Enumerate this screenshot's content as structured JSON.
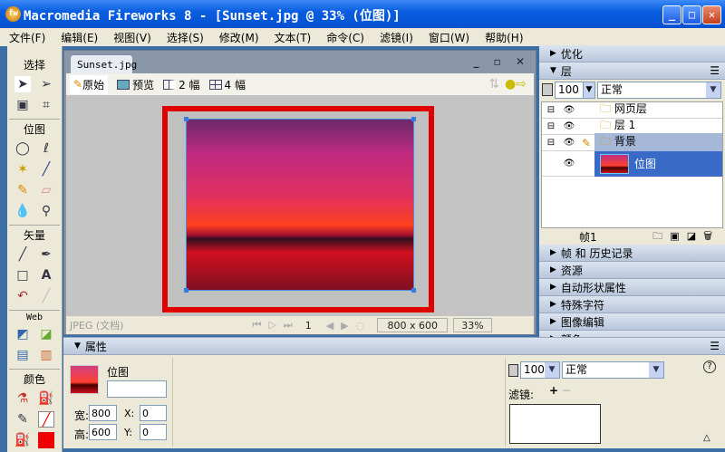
{
  "window": {
    "title": "Macromedia Fireworks 8 - [Sunset.jpg @  33% (位图)]",
    "controls": [
      "_",
      "□",
      "✕"
    ]
  },
  "menu": [
    "文件(F)",
    "编辑(E)",
    "视图(V)",
    "选择(S)",
    "修改(M)",
    "文本(T)",
    "命令(C)",
    "滤镜(I)",
    "窗口(W)",
    "帮助(H)"
  ],
  "toolbox": {
    "sections": [
      "选择",
      "位图",
      "矢量",
      "Web",
      "颜色"
    ]
  },
  "document": {
    "tab": "Sunset.jpg",
    "view_buttons": [
      "原始",
      "预览",
      "2 幅",
      "4 幅"
    ],
    "status_type": "JPEG (文档)",
    "frame": "1",
    "size": "800 x 600",
    "zoom": "33%"
  },
  "panels": {
    "optimize": "优化",
    "layers": "层",
    "opacity": "100",
    "blend": "正常",
    "layer_rows": [
      "网页层",
      "层 1",
      "背景",
      "位图"
    ],
    "frame_label": "帧1",
    "collapsed": [
      "帧 和 历史记录",
      "资源",
      "自动形状属性",
      "特殊字符",
      "图像编辑",
      "颜色"
    ]
  },
  "properties": {
    "title": "属性",
    "object_type": "位图",
    "object_name": "",
    "width_label": "宽:",
    "width": "800",
    "height_label": "高:",
    "height": "600",
    "x_label": "X:",
    "x": "0",
    "y_label": "Y:",
    "y": "0",
    "opacity": "100",
    "blend": "正常",
    "filters_label": "滤镜:",
    "help": "?"
  }
}
